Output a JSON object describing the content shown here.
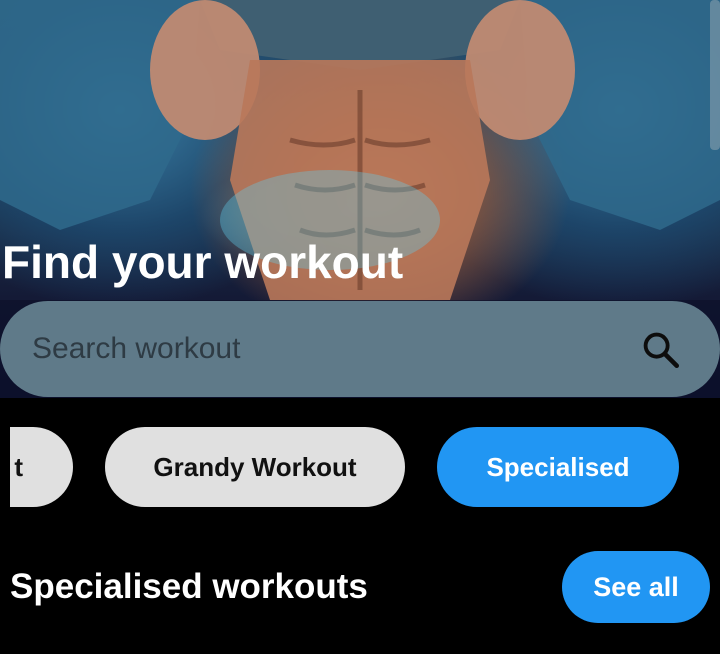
{
  "hero": {
    "title": "Find your workout",
    "image": "fitness-hero-photo"
  },
  "search": {
    "placeholder": "Search workout",
    "icon": "search-icon"
  },
  "categories": [
    {
      "label": "t",
      "selected": false
    },
    {
      "label": "Grandy Workout",
      "selected": false
    },
    {
      "label": "Specialised",
      "selected": true
    }
  ],
  "section": {
    "title": "Specialised workouts",
    "see_all_label": "See all"
  },
  "colors": {
    "background": "#000000",
    "accent": "#2196f3",
    "chip_inactive": "#e0e0e0",
    "search_bg": "#5f7a89"
  }
}
